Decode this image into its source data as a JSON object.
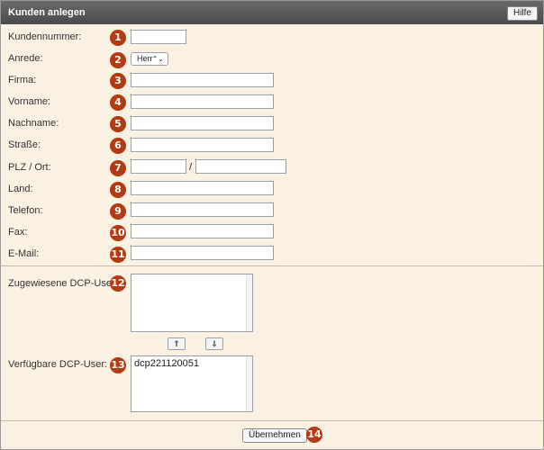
{
  "header": {
    "title": "Kunden anlegen",
    "help_label": "Hilfe"
  },
  "form": {
    "labels": {
      "kundennummer": "Kundennummer:",
      "anrede": "Anrede:",
      "firma": "Firma:",
      "vorname": "Vorname:",
      "nachname": "Nachname:",
      "strasse": "Straße:",
      "plz_ort": "PLZ / Ort:",
      "land": "Land:",
      "telefon": "Telefon:",
      "fax": "Fax:",
      "email": "E-Mail:"
    },
    "anrede_selected": "Herr",
    "plz_separator": "/"
  },
  "users": {
    "assigned_label": "Zugewiesene DCP-User:",
    "available_label": "Verfügbare DCP-User:",
    "available_items": [
      "dcp221120051"
    ],
    "move_up_symbol": "⇑",
    "move_down_symbol": "⇓"
  },
  "footer": {
    "submit_label": "Übernehmen"
  },
  "badges": [
    "1",
    "2",
    "3",
    "4",
    "5",
    "6",
    "7",
    "8",
    "9",
    "10",
    "11",
    "12",
    "13",
    "14"
  ],
  "colors": {
    "badge": "#b33a12",
    "panel_bg": "#fbf1e3",
    "titlebar": "#555555"
  }
}
